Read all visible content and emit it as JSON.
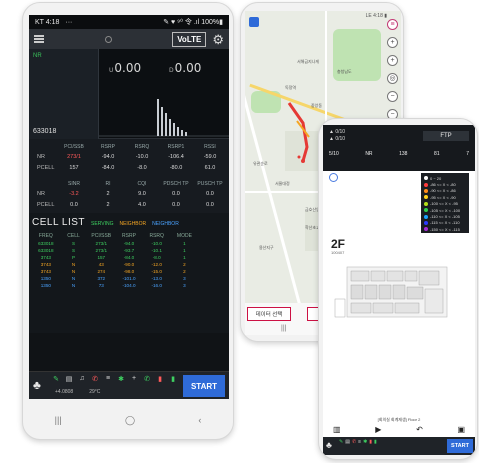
{
  "phone1": {
    "status": {
      "carrier": "KT 4:18",
      "dots": "···",
      "signal": "✎ ♥ ⁹⁰ 令 .ıl 100%▮"
    },
    "topbar": {
      "volte": "VoLTE"
    },
    "graph": {
      "nr_tag": "NR",
      "pci": "633018",
      "ul_unit": "U",
      "ul_value": "0.00",
      "dl_unit": "D",
      "dl_value": "0.00"
    },
    "table1": {
      "headers": [
        "",
        "PCI/SSB",
        "RSRP",
        "RSRQ",
        "RSRP1",
        "RSSI"
      ],
      "rows": [
        [
          "NR",
          "273/1",
          "-94.0",
          "-10.0",
          "-106.4",
          "-59.0"
        ],
        [
          "PCELL",
          "157",
          "-84.0",
          "-8.0",
          "-80.0",
          "61.0"
        ]
      ]
    },
    "table2": {
      "headers": [
        "",
        "SINR",
        "RI",
        "CQI",
        "PDSCH TP",
        "PUSCH TP"
      ],
      "rows": [
        [
          "NR",
          "-3.2",
          "2",
          "9.0",
          "0.0",
          "0.0"
        ],
        [
          "PCELL",
          "0.0",
          "2",
          "4.0",
          "0.0",
          "0.0"
        ]
      ]
    },
    "cell_list": {
      "title": "CELL LIST",
      "legend": [
        "SERVING",
        "NEIGHBOR",
        "NEIGHBOR"
      ],
      "headers": [
        "FREQ",
        "CELL",
        "PCI/SSB",
        "RSRP",
        "RSRQ",
        "MODE",
        ""
      ],
      "rows": [
        {
          "kind": "serv",
          "cells": [
            "633018",
            "S",
            "273/1",
            "-94.0",
            "-10.0",
            "1",
            ""
          ]
        },
        {
          "kind": "serv",
          "cells": [
            "633018",
            "S",
            "273/1",
            "-93.7",
            "-10.1",
            "1",
            ""
          ]
        },
        {
          "kind": "serv",
          "cells": [
            "3743",
            "P",
            "157",
            "-84.0",
            "-8.0",
            "1",
            ""
          ]
        },
        {
          "kind": "nb",
          "cells": [
            "3743",
            "N",
            "43",
            "-90.0",
            "-12.0",
            "2",
            ""
          ]
        },
        {
          "kind": "nb",
          "cells": [
            "3743",
            "N",
            "274",
            "-98.0",
            "-15.0",
            "2",
            ""
          ]
        },
        {
          "kind": "nb2",
          "cells": [
            "1350",
            "N",
            "372",
            "-101.0",
            "-13.0",
            "3",
            ""
          ]
        },
        {
          "kind": "nb2",
          "cells": [
            "1350",
            "N",
            "73",
            "-104.0",
            "-16.0",
            "3",
            ""
          ]
        }
      ]
    },
    "toolbar": {
      "start_label": "START",
      "stat_1": "+4.0808",
      "stat_2": "29°C"
    },
    "nav": {
      "recent": "|||",
      "home": "◯",
      "back": "‹"
    }
  },
  "phone2": {
    "status": "LE 4:18 ▮",
    "map_labels": [
      "서해금지나게",
      "충청남도",
      "독정역",
      "중앙동",
      "유관순로",
      "서울대정",
      "금호산업",
      "학산초교",
      "용산지구",
      "우리은행"
    ],
    "data_button": "데이터 선택",
    "nav": {
      "recent": "|||"
    }
  },
  "phone3": {
    "info_line1": "▲ 0/10",
    "info_line2": "▲ 0/10",
    "ftp_label": "FTP",
    "metrics": [
      "5/10",
      "NR",
      "138",
      "81",
      "7"
    ],
    "legend": [
      {
        "label": "0 ~ 20",
        "color": "#ffffff"
      },
      {
        "label": "-86 <= X < -80",
        "color": "#ff3b3b"
      },
      {
        "label": "-90 <= X < -86",
        "color": "#ff8c1a"
      },
      {
        "label": "-95 <= X < -90",
        "color": "#ffd21a"
      },
      {
        "label": "-100 <= X < -95",
        "color": "#b6e01a"
      },
      {
        "label": "-105 <= X < -100",
        "color": "#2fd14b"
      },
      {
        "label": "-110 <= X < -105",
        "color": "#1aa3ff"
      },
      {
        "label": "-115 <= X < -110",
        "color": "#2a3bff"
      },
      {
        "label": "-150 <= X < -115",
        "color": "#a62bd6"
      }
    ],
    "floor_title": "2F",
    "floor_sub": "100407",
    "caption": "[회의실 회계재생] Floor 2",
    "toolbar_start": "START"
  }
}
